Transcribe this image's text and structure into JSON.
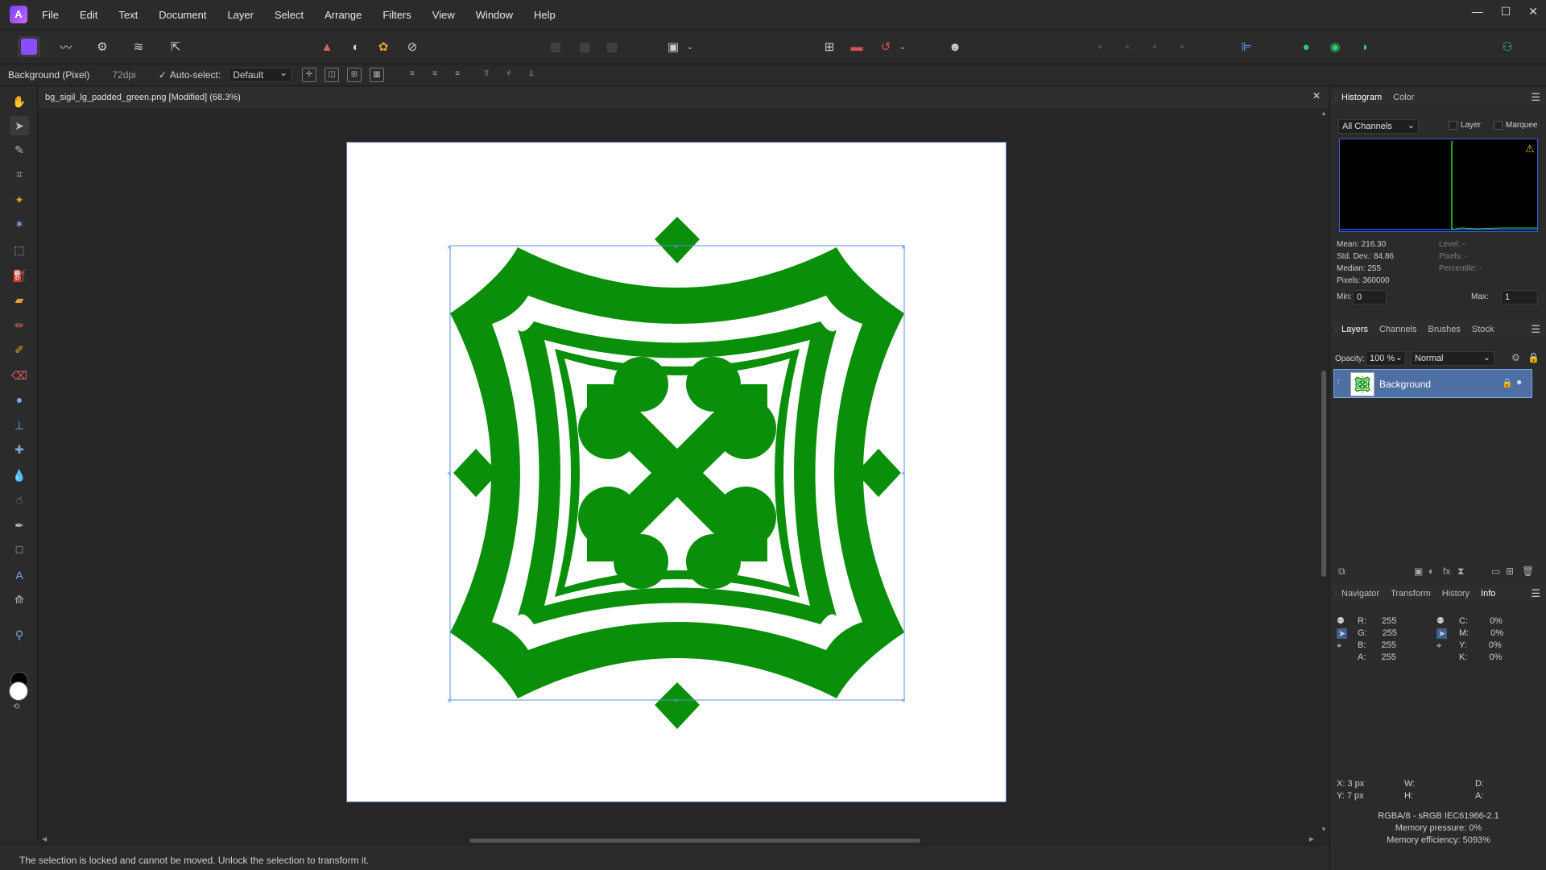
{
  "menubar": {
    "items": [
      "File",
      "Edit",
      "Text",
      "Document",
      "Layer",
      "Select",
      "Arrange",
      "Filters",
      "View",
      "Window",
      "Help"
    ]
  },
  "window_controls": {
    "minimize": "—",
    "maximize": "☐",
    "close": "✕"
  },
  "context_toolbar": {
    "layer_label": "Background (Pixel)",
    "dpi": "72dpi",
    "auto_select_label": "Auto-select:",
    "auto_select_value": "Default"
  },
  "document": {
    "tab_title": "bg_sigil_lg_padded_green.png [Modified] (68.3%)",
    "close": "✕",
    "image_fill_color": "#0a8f0a"
  },
  "status_bar": {
    "message": "The selection is locked and cannot be moved. Unlock the selection to transform it."
  },
  "histogram_panel": {
    "tabs": [
      "Histogram",
      "Color"
    ],
    "channel": "All Channels",
    "layer_label": "Layer",
    "marquee_label": "Marquee",
    "stats_left": [
      "Mean: 216.30",
      "Std. Dev.: 84.86",
      "Median: 255",
      "Pixels: 360000"
    ],
    "stats_right": [
      "Level: -",
      "Pixels: -",
      "Percentile: -"
    ],
    "min_label": "Min:",
    "min_value": "0",
    "max_label": "Max:",
    "max_value": "1"
  },
  "layers_panel": {
    "tabs": [
      "Layers",
      "Channels",
      "Brushes",
      "Stock"
    ],
    "opacity_label": "Opacity:",
    "opacity_value": "100 %",
    "blend_mode": "Normal",
    "layer_name": "Background"
  },
  "info_panel": {
    "tabs": [
      "Navigator",
      "Transform",
      "History",
      "Info"
    ],
    "rgba": [
      {
        "label": "R:",
        "value": "255"
      },
      {
        "label": "G:",
        "value": "255"
      },
      {
        "label": "B:",
        "value": "255"
      },
      {
        "label": "A:",
        "value": "255"
      }
    ],
    "cmyk": [
      {
        "label": "C:",
        "value": "0%"
      },
      {
        "label": "M:",
        "value": "0%"
      },
      {
        "label": "Y:",
        "value": "0%"
      },
      {
        "label": "K:",
        "value": "0%"
      }
    ],
    "x": "X: 3 px",
    "y": "Y: 7 px",
    "w": "W:",
    "h": "H:",
    "d": "D:",
    "a": "A:",
    "footer": [
      "RGBA/8 - sRGB IEC61966-2.1",
      "Memory pressure: 0%",
      "Memory efficiency: 5093%"
    ]
  }
}
